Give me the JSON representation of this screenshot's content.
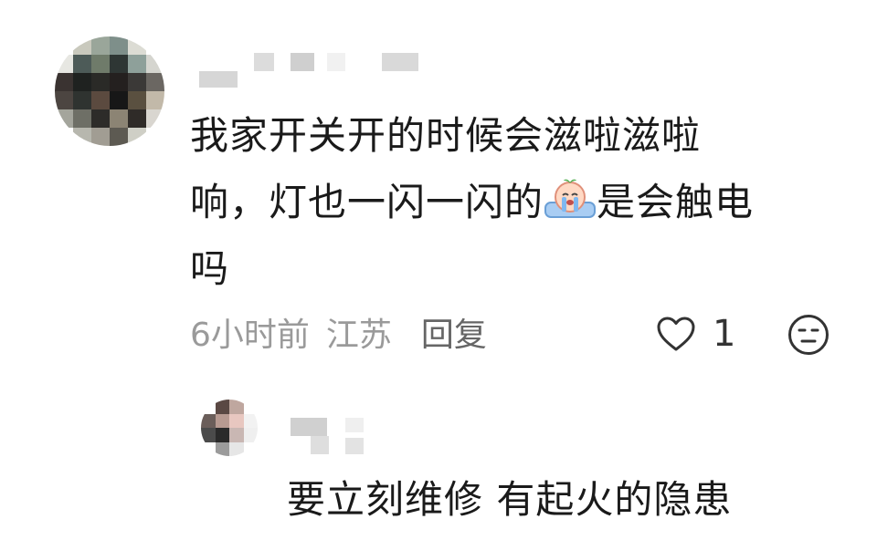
{
  "comment": {
    "line1": "我家开关开的时候会滋啦滋啦",
    "line2_before_emoji": "响，灯也一闪一闪的",
    "line2_after_emoji": "是会触电",
    "line3": "吗",
    "emoji_icon": "crying-face-emoji-icon",
    "time": "6小时前",
    "location": "江苏",
    "reply_label": "回复",
    "like_count": "1"
  },
  "reply": {
    "text": "要立刻维修 有起火的隐患"
  },
  "colors": {
    "text": "#1a1a1a",
    "meta": "#9a9a9a",
    "icon": "#333333"
  }
}
